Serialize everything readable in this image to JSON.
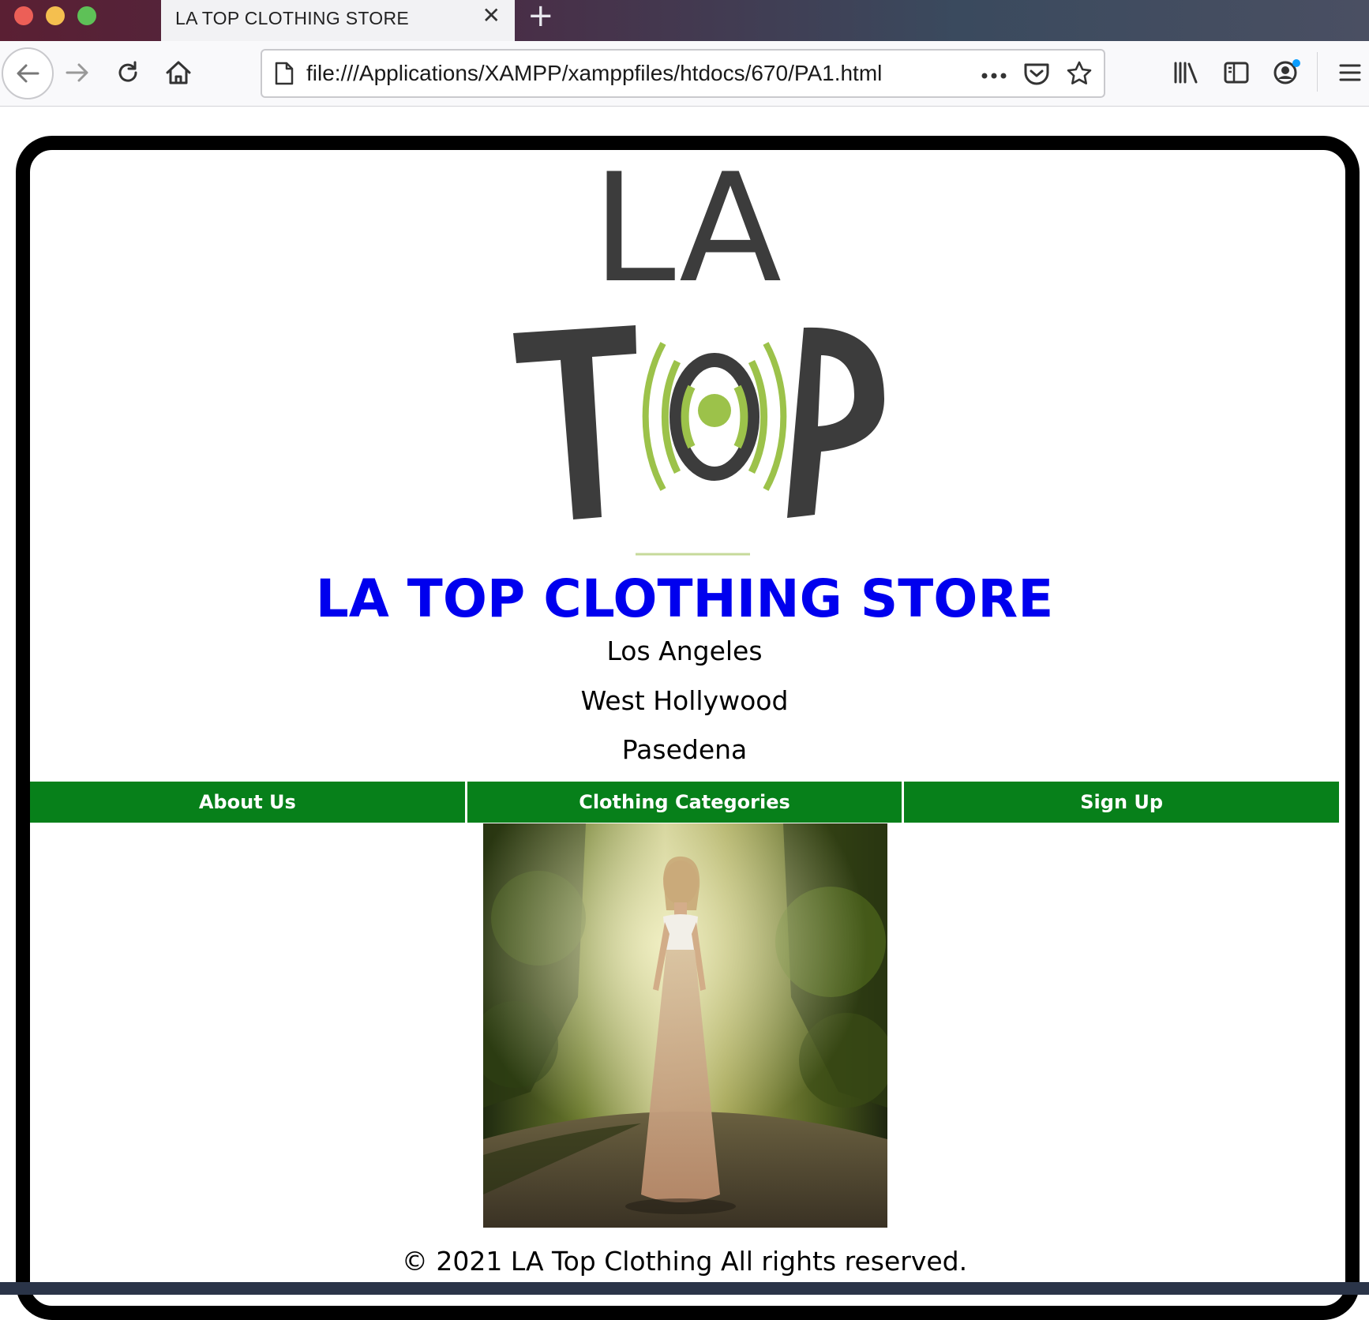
{
  "browser": {
    "tab_title": "LA TOP CLOTHING STORE",
    "tab_close_icon": "close-icon",
    "new_tab_icon": "plus-icon",
    "url": "file:///Applications/XAMPP/xamppfiles/htdocs/670/PA1.html",
    "toolbar_icons": [
      "back-arrow-icon",
      "forward-arrow-icon",
      "reload-icon",
      "home-icon",
      "page-icon",
      "more-dots-icon",
      "pocket-icon",
      "star-icon",
      "library-icon",
      "sidebar-icon",
      "account-icon",
      "hamburger-menu-icon"
    ]
  },
  "colors": {
    "title_blue": "#0000ee",
    "menu_green": "#07801a",
    "logo_dark": "#3c3c3c",
    "logo_green": "#9cc24a"
  },
  "page": {
    "logo_text_top": "LA",
    "logo_text_bottom": "TOP",
    "title": "LA TOP CLOTHING STORE",
    "locations": [
      "Los Angeles",
      "West Hollywood",
      "Pasedena"
    ],
    "menu": [
      "About Us",
      "Clothing Categories",
      "Sign Up"
    ],
    "footer": "© 2021 LA Top Clothing All rights reserved."
  }
}
